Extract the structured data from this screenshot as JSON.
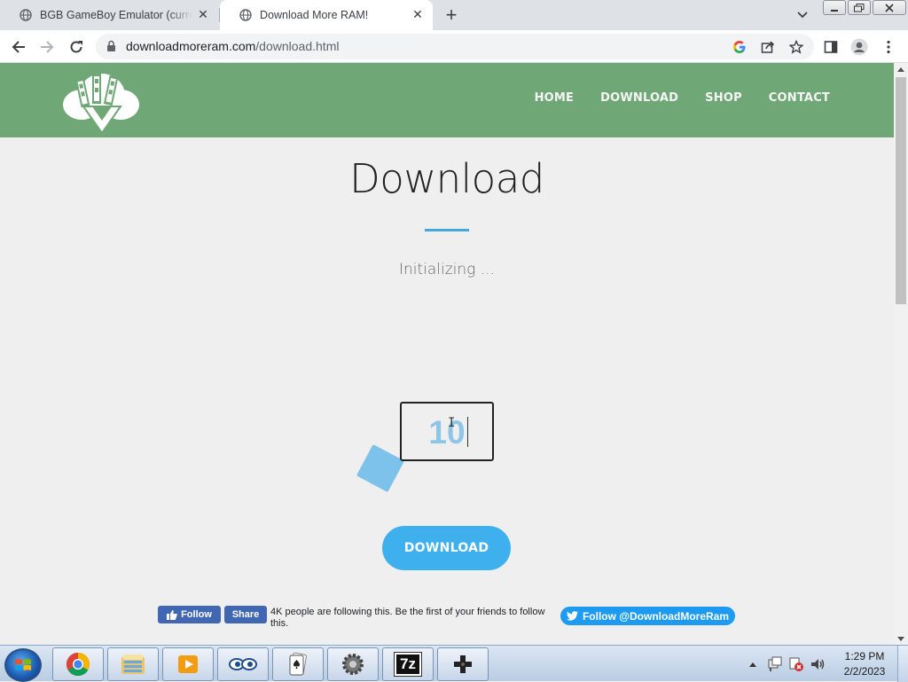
{
  "browser": {
    "tabs": [
      {
        "title": "BGB GameBoy Emulator (current",
        "active": false
      },
      {
        "title": "Download More RAM!",
        "active": true
      }
    ],
    "new_tab_symbol": "+",
    "close_symbol": "✕",
    "url_domain": "downloadmoreram.com",
    "url_path": "/download.html"
  },
  "site": {
    "nav": [
      "HOME",
      "DOWNLOAD",
      "SHOP",
      "CONTACT"
    ],
    "title": "Download",
    "status": "Initializing ...",
    "counter": "10",
    "download_button": "DOWNLOAD",
    "colors": {
      "header": "#6fa876",
      "accent": "#3fa9e0",
      "button": "#3fb0ee"
    }
  },
  "social": {
    "fb_follow": "Follow",
    "fb_share": "Share",
    "fb_text": "4K people are following this. Be the first of your friends to follow this.",
    "twitter": "Follow @DownloadMoreRam"
  },
  "taskbar": {
    "apps": [
      "chrome-icon",
      "file-explorer-icon",
      "media-player-icon",
      "eyes-icon",
      "solitaire-icon",
      "settings-gear-icon",
      "7zip-icon",
      "gamepad-icon"
    ],
    "app_7z_label": "7z",
    "time": "1:29 PM",
    "date": "2/2/2023"
  }
}
